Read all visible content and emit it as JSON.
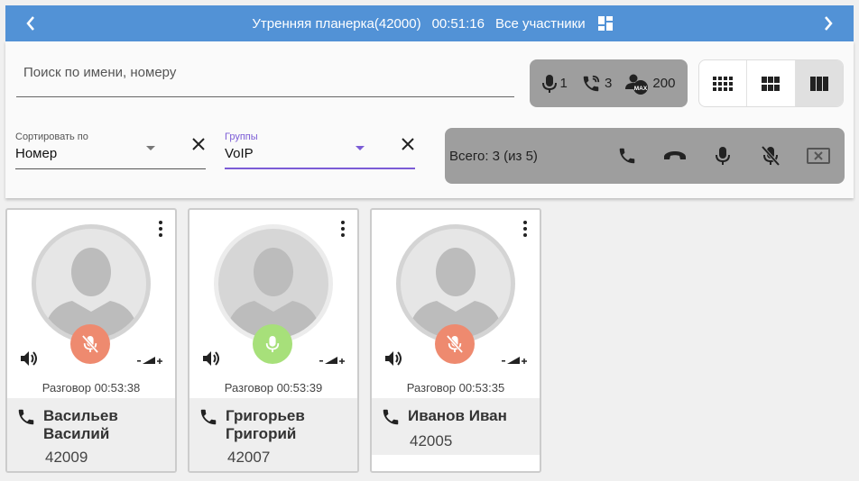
{
  "header": {
    "title": "Утренняя планерка(42000)",
    "duration": "00:51:16",
    "filter": "Все участники"
  },
  "search": {
    "placeholder": "Поиск по имени, номеру"
  },
  "stats": {
    "speakers": "1",
    "calls": "3",
    "max": "200",
    "max_badge": "MAX"
  },
  "sort": {
    "label": "Сортировать по",
    "value": "Номер"
  },
  "groups": {
    "label": "Группы",
    "value": "VoIP"
  },
  "actions": {
    "total": "Всего: 3 (из 5)"
  },
  "participants": [
    {
      "name_line1": "Васильев",
      "name_line2": "Василий",
      "number": "42009",
      "status": "Разговор 00:53:38",
      "mic": "muted"
    },
    {
      "name_line1": "Григорьев",
      "name_line2": "Григорий",
      "number": "42007",
      "status": "Разговор 00:53:39",
      "mic": "active"
    },
    {
      "name_line1": "Иванов Иван",
      "name_line2": "",
      "number": "42005",
      "status": "Разговор 00:53:35",
      "mic": "muted"
    }
  ],
  "colors": {
    "header": "#5292d6",
    "muted": "#ee8a6f",
    "active": "#a7e07a",
    "groups_accent": "#7b5cd6"
  }
}
